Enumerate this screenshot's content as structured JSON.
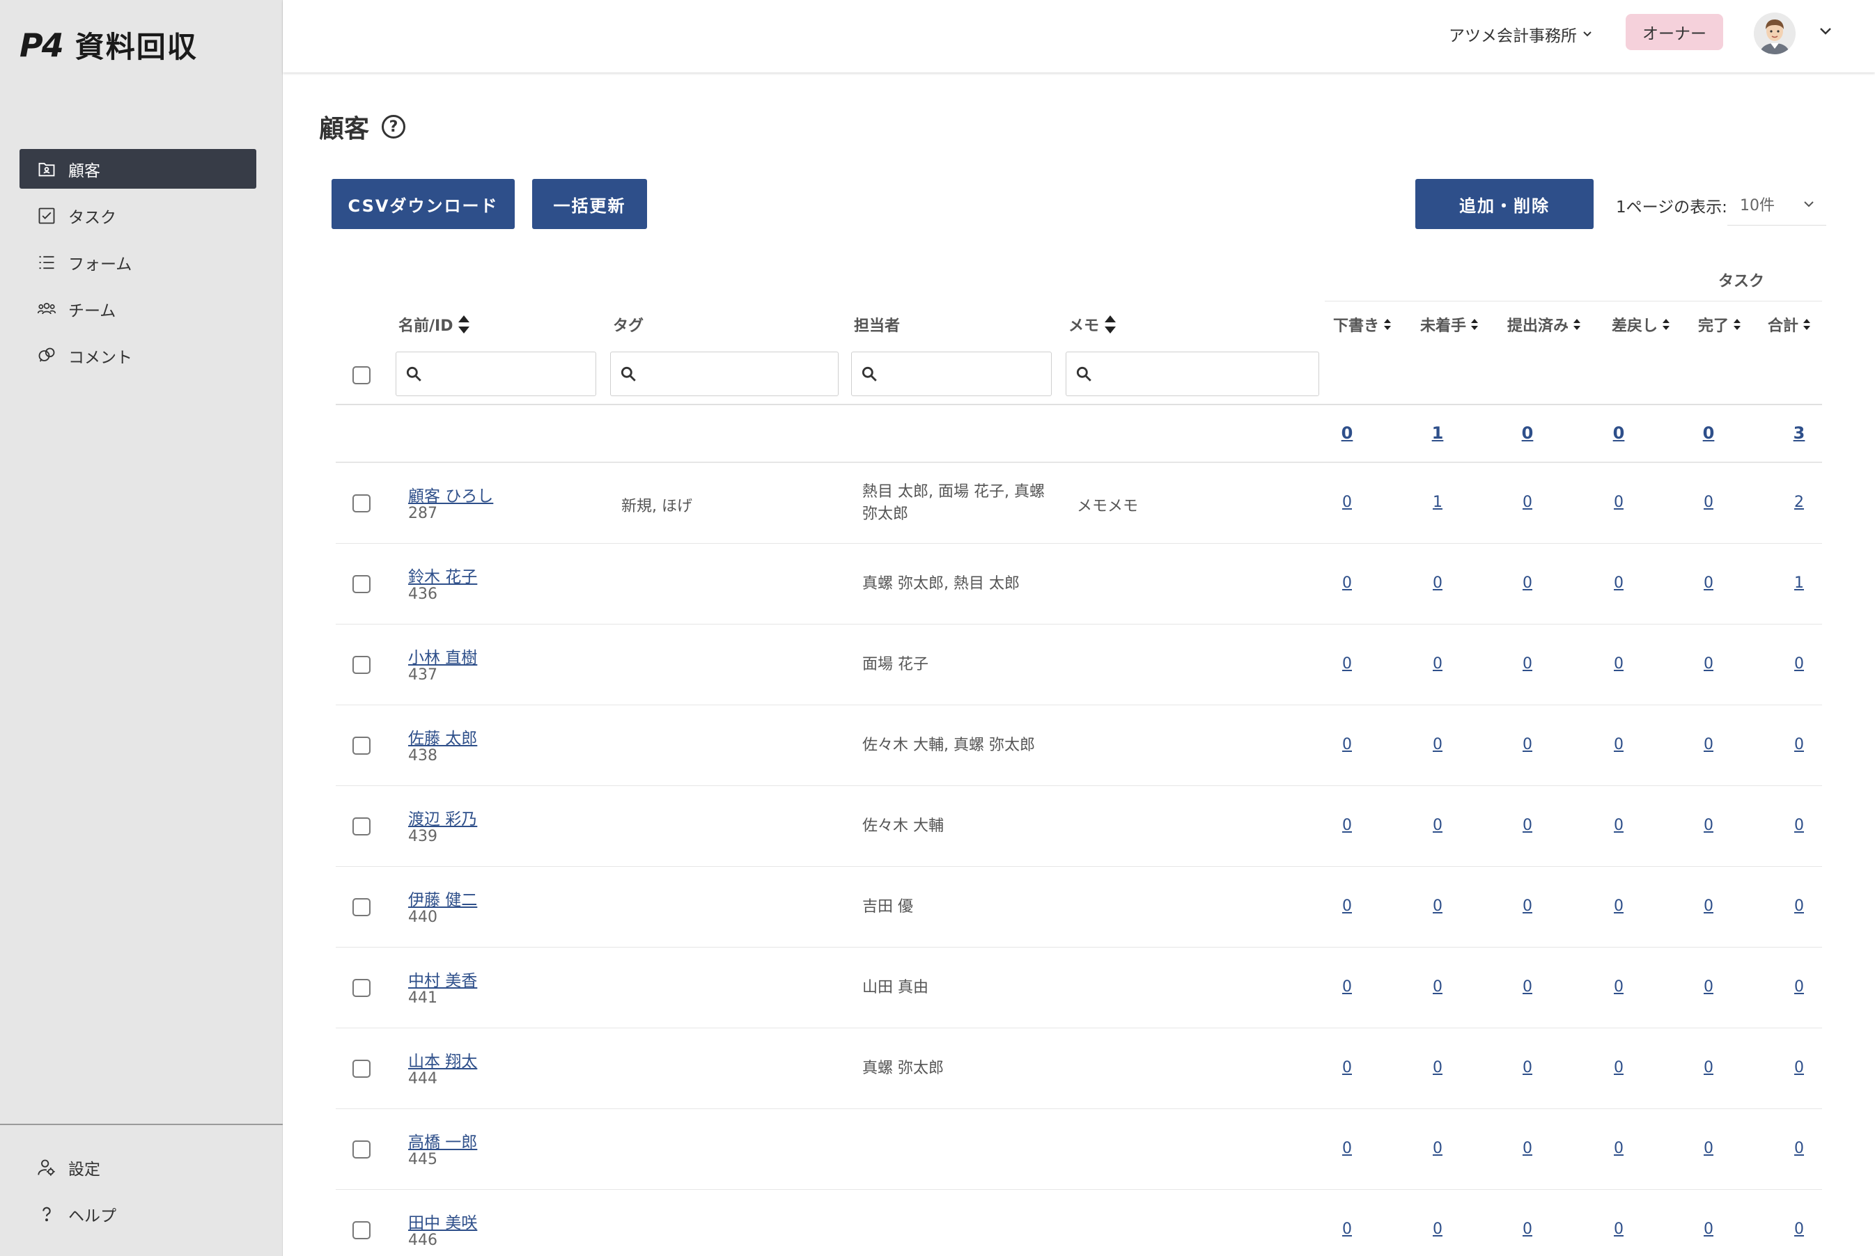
{
  "app": {
    "logo_mark": "P4",
    "logo_text": "資料回収"
  },
  "sidebar": {
    "items": [
      {
        "label": "顧客",
        "icon": "customer-icon",
        "active": true
      },
      {
        "label": "タスク",
        "icon": "task-check-icon",
        "active": false
      },
      {
        "label": "フォーム",
        "icon": "form-list-icon",
        "active": false
      },
      {
        "label": "チーム",
        "icon": "team-icon",
        "active": false
      },
      {
        "label": "コメント",
        "icon": "comment-icon",
        "active": false
      }
    ],
    "bottom_items": [
      {
        "label": "設定",
        "icon": "settings-user-icon"
      },
      {
        "label": "ヘルプ",
        "icon": "help-icon"
      }
    ]
  },
  "header": {
    "office": "アツメ会計事務所",
    "role": "オーナー",
    "role_color": "#f5d1db"
  },
  "main": {
    "title": "顧客",
    "help_glyph": "?",
    "buttons": {
      "csv": "CSVダウンロード",
      "bulk": "一括更新",
      "add_remove": "追加・削除"
    },
    "perpage_label": "1ページの表示:",
    "perpage_value": "10件",
    "accent_color": "#2e4f8a"
  },
  "table": {
    "task_group": "タスク",
    "columns": {
      "name": "名前/ID",
      "tag": "タグ",
      "assignee": "担当者",
      "memo": "メモ",
      "draft": "下書き",
      "not_started": "未着手",
      "submitted": "提出済み",
      "returned": "差戻し",
      "done": "完了",
      "total": "合計"
    },
    "totals": [
      "0",
      "1",
      "0",
      "0",
      "0",
      "3"
    ],
    "rows": [
      {
        "name": "顧客 ひろし",
        "id": "287",
        "tag": "新規, ほげ",
        "assignee": "熱目 太郎, 面場 花子, 真螺 弥太郎",
        "memo": "メモメモ",
        "counts": [
          "0",
          "1",
          "0",
          "0",
          "0",
          "2"
        ]
      },
      {
        "name": "鈴木 花子",
        "id": "436",
        "tag": "",
        "assignee": "真螺 弥太郎, 熱目 太郎",
        "memo": "",
        "counts": [
          "0",
          "0",
          "0",
          "0",
          "0",
          "1"
        ]
      },
      {
        "name": "小林 直樹",
        "id": "437",
        "tag": "",
        "assignee": "面場 花子",
        "memo": "",
        "counts": [
          "0",
          "0",
          "0",
          "0",
          "0",
          "0"
        ]
      },
      {
        "name": "佐藤 太郎",
        "id": "438",
        "tag": "",
        "assignee": "佐々木 大輔, 真螺 弥太郎",
        "memo": "",
        "counts": [
          "0",
          "0",
          "0",
          "0",
          "0",
          "0"
        ]
      },
      {
        "name": "渡辺 彩乃",
        "id": "439",
        "tag": "",
        "assignee": "佐々木 大輔",
        "memo": "",
        "counts": [
          "0",
          "0",
          "0",
          "0",
          "0",
          "0"
        ]
      },
      {
        "name": "伊藤 健二",
        "id": "440",
        "tag": "",
        "assignee": "吉田 優",
        "memo": "",
        "counts": [
          "0",
          "0",
          "0",
          "0",
          "0",
          "0"
        ]
      },
      {
        "name": "中村 美香",
        "id": "441",
        "tag": "",
        "assignee": "山田 真由",
        "memo": "",
        "counts": [
          "0",
          "0",
          "0",
          "0",
          "0",
          "0"
        ]
      },
      {
        "name": "山本 翔太",
        "id": "444",
        "tag": "",
        "assignee": "真螺 弥太郎",
        "memo": "",
        "counts": [
          "0",
          "0",
          "0",
          "0",
          "0",
          "0"
        ]
      },
      {
        "name": "高橋 一郎",
        "id": "445",
        "tag": "",
        "assignee": "",
        "memo": "",
        "counts": [
          "0",
          "0",
          "0",
          "0",
          "0",
          "0"
        ]
      },
      {
        "name": "田中 美咲",
        "id": "446",
        "tag": "",
        "assignee": "",
        "memo": "",
        "counts": [
          "0",
          "0",
          "0",
          "0",
          "0",
          "0"
        ]
      }
    ]
  }
}
